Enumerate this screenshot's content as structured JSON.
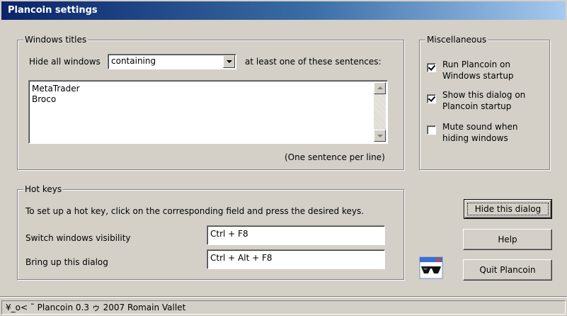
{
  "window": {
    "title": "Plancoin settings"
  },
  "windows_titles": {
    "legend": "Windows titles",
    "hide_label": "Hide all windows",
    "mode_select_value": "containing",
    "suffix_label": "at least one of these sentences:",
    "sentences": [
      "MetaTrader",
      "Broco"
    ],
    "hint": "(One sentence per line)"
  },
  "misc": {
    "legend": "Miscellaneous",
    "options": [
      {
        "line1": "Run Plancoin on",
        "line2": "Windows startup",
        "checked": true
      },
      {
        "line1": "Show this dialog on",
        "line2": "Plancoin startup",
        "checked": true
      },
      {
        "line1": "Mute sound when",
        "line2": "hiding windows",
        "checked": false
      }
    ]
  },
  "hotkeys": {
    "legend": "Hot keys",
    "instructions": "To set up a hot key, click on the corresponding field and press the desired keys.",
    "switch_label": "Switch windows visibility",
    "switch_value": "Ctrl + F8",
    "bringup_label": "Bring up this dialog",
    "bringup_value": "Ctrl + Alt + F8"
  },
  "buttons": {
    "hide_dialog": "Hide this dialog",
    "help": "Help",
    "quit": "Quit Plancoin"
  },
  "icons": {
    "app_icon": "sunglasses-icon"
  },
  "status": {
    "text": "¥_o< ˜ Plancoin 0.3 ゥ 2007 Romain Vallet"
  }
}
